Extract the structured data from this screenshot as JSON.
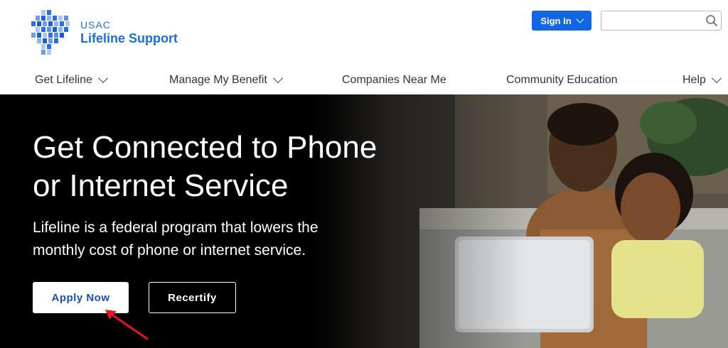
{
  "brand": {
    "org": "USAC",
    "name": "Lifeline Support"
  },
  "header": {
    "signin_label": "Sign In",
    "search_value": "",
    "search_placeholder": ""
  },
  "nav": {
    "items": [
      {
        "label": "Get Lifeline",
        "has_menu": true
      },
      {
        "label": "Manage My Benefit",
        "has_menu": true
      },
      {
        "label": "Companies Near Me",
        "has_menu": false
      },
      {
        "label": "Community Education",
        "has_menu": false
      },
      {
        "label": "Help",
        "has_menu": true
      }
    ]
  },
  "hero": {
    "title": "Get Connected to Phone or Internet Service",
    "text": "Lifeline is a federal program that lowers the monthly cost of phone or internet service.",
    "apply_label": "Apply Now",
    "recertify_label": "Recertify"
  },
  "colors": {
    "brand_blue": "#1266e3",
    "hero_bg": "#000000",
    "annotation_red": "#e0191e"
  },
  "icons": [
    "usac-logo",
    "chevron-down-icon",
    "search-icon",
    "red-arrow-icon"
  ]
}
